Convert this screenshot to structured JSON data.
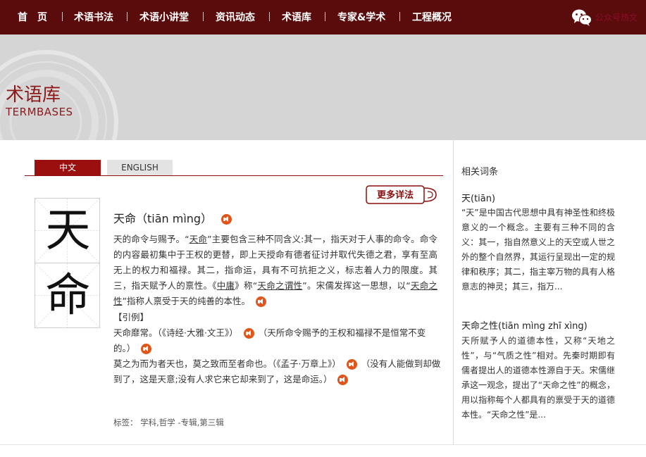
{
  "nav": {
    "items": [
      "首　页",
      "术语书法",
      "术语小讲堂",
      "资讯动态",
      "术语库",
      "专家&学术",
      "工程概况"
    ],
    "wechat_label": "公众号热文"
  },
  "banner": {
    "title_cn": "术语库",
    "title_en": "TERMBASES"
  },
  "tabs": {
    "zh": "中文",
    "en": "ENGLISH"
  },
  "more_button": "更多详法",
  "entry": {
    "chars": [
      "天",
      "命"
    ],
    "headword": "天命（tiān mìng）",
    "definition": {
      "p1": "天的命令与赐予。“",
      "p2": "天命",
      "p3": "”主要包含三种不同含义:其一，指天对于人事的命令。命令的内容最初集中于王权的更替，即上天授命有德者征讨并取代失德之君，享有至高无上的权力和福禄。其二，指命运，具有不可抗拒之义，标志着人力的限度。其三，指天赋予人的禀性。《",
      "p4": "中庸",
      "p5": "》称“",
      "p6": "天命之谓性",
      "p7": "”。宋儒发挥这一思想，以“",
      "p8": "天命之性",
      "p9": "”指称人禀受于天的纯善的本性。"
    },
    "quote_header": "【引例】",
    "example1": {
      "a": "天命",
      "b": "靡常。（《诗经·大雅·文王》）",
      "c": "（天所命令赐予的王权和福禄不是恒常不变的。）"
    },
    "example2": {
      "a": "莫之为而为者天也，莫之致而至者命也。（《孟子·万章上》）",
      "b": "（没有人能做到却做到了，这是天意;没有人求它来它却来到了，这是命运。）"
    },
    "tags": "标签：  学科,哲学 -专辑,第三辑"
  },
  "sidebar": {
    "title": "相关词条",
    "items": [
      {
        "head": "天(tiān)",
        "body": "“天”是中国古代思想中具有神圣性和终极意义的一个概念。主要有三种不同的含义：其一，指自然意义上的天空或人世之外的整个自然界，其运行呈现出一定的规律和秩序；其二，指主宰万物的具有人格意志的神灵；其三，指万..."
      },
      {
        "head": "天命之性(tiān mìng zhī xìng)",
        "body": "天所赋予人的道德本性，又称“天地之性”，与“气质之性”相对。先秦时期即有儒者提出人的道德本性源自于天。宋儒继承这一观念，提出了“天命之性”的概念，用以指称每个人都具有的禀受于天的道德本性。“天命之性”是..."
      }
    ]
  },
  "colors": {
    "nav_bg": "#5a0b0b",
    "accent": "#9b0f0f",
    "banner_bg": "#d5d5d5",
    "speaker": "#e2551a"
  }
}
